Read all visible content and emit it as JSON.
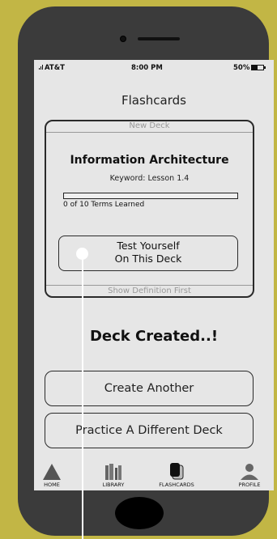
{
  "status_bar": {
    "carrier": "AT&T",
    "time": "8:00 PM",
    "battery": "50%"
  },
  "header": {
    "title": "Flashcards"
  },
  "deck_card": {
    "top_label": "New Deck",
    "title": "Information Architecture",
    "keyword": "Keyword: Lesson 1.4",
    "progress_fraction": 0,
    "progress_text": "0 of 10 Terms Learned",
    "test_button_line1": "Test Yourself",
    "test_button_line2": "On This Deck",
    "bottom_label": "Show Definition First"
  },
  "message": "Deck Created..!",
  "actions": {
    "create_another": "Create Another",
    "practice_different": "Practice A Different Deck"
  },
  "tabbar": {
    "items": [
      {
        "label": "HOME",
        "icon": "home-icon"
      },
      {
        "label": "LIBRARY",
        "icon": "library-icon"
      },
      {
        "label": "FLASHCARDS",
        "icon": "flashcards-icon"
      },
      {
        "label": "PROFILE",
        "icon": "profile-icon"
      }
    ]
  },
  "colors": {
    "background": "#c2b645",
    "phone_body": "#3b3b3b",
    "screen": "#e6e6e6"
  }
}
